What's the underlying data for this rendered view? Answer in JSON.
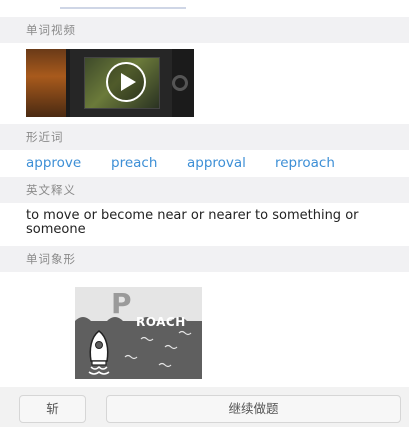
{
  "sections": {
    "video": {
      "title": "单词视频"
    },
    "similar": {
      "title": "形近词"
    },
    "definition": {
      "title": "英文释义"
    },
    "pictogram": {
      "title": "单词象形"
    }
  },
  "similar_words": [
    "approve",
    "preach",
    "approval",
    "reproach"
  ],
  "definition_text": "to move or become near or nearer to something or someone",
  "pictogram": {
    "letter": "P",
    "caption": "ROACH"
  },
  "bottom_bar": {
    "slash_label": "斩",
    "continue_label": "继续做题"
  },
  "colors": {
    "link": "#3d8fd6",
    "section_header_bg": "#f1f1f3"
  },
  "icons": [
    "play-icon",
    "boat-icon"
  ]
}
